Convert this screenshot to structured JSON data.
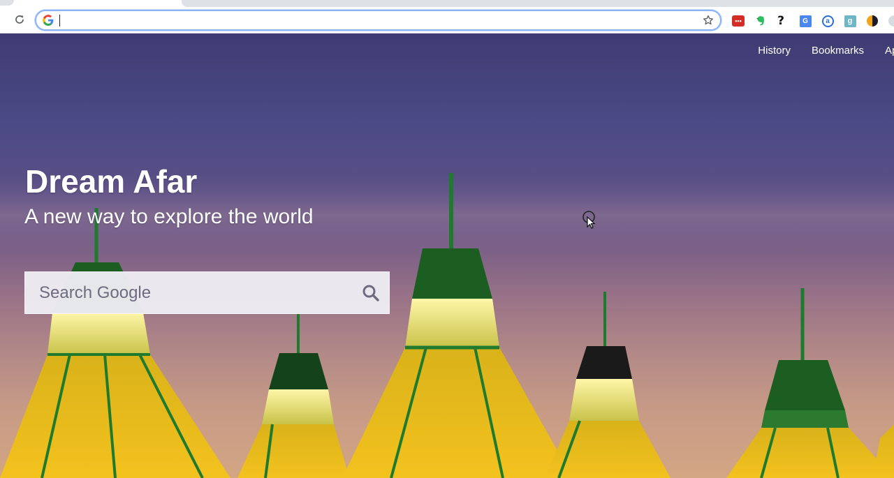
{
  "browser": {
    "address_bar": {
      "value": "",
      "placeholder": ""
    }
  },
  "icons": {
    "reload": "reload-icon",
    "google": "google-icon",
    "bookmark_star": "star-icon",
    "search": "search-icon"
  },
  "extensions": [
    "lastpass",
    "evernote",
    "help",
    "google-translate",
    "at-sign",
    "g-extension",
    "dark-moon",
    "partial-extension"
  ],
  "page": {
    "nav": [
      {
        "label": "History"
      },
      {
        "label": "Bookmarks"
      },
      {
        "label": "Ap"
      }
    ],
    "title": "Dream Afar",
    "tagline": "A new way to explore the world",
    "search": {
      "placeholder": "Search Google",
      "value": ""
    }
  },
  "colors": {
    "sky_top": "#3f3b72",
    "sky_bottom": "#d3a684",
    "tent_yellow": "#f0c020",
    "tent_green": "#1f7a2e",
    "omnibox_focus": "#8ab4f8"
  }
}
